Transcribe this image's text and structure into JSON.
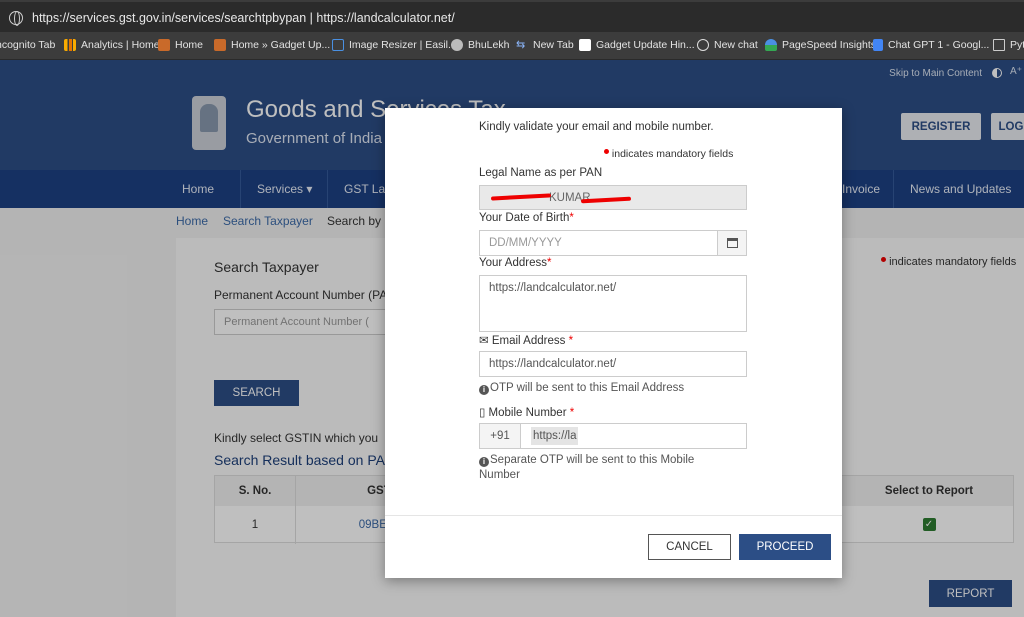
{
  "browser": {
    "url": "https://services.gst.gov.in/services/searchtpbypan | https://landcalculator.net/",
    "bookmarks": [
      {
        "label": "ncognito Tab",
        "icon": "incognito-icon",
        "color": "#888888"
      },
      {
        "label": "Analytics | Home",
        "icon": "analytics-icon",
        "color": "#f9ab00"
      },
      {
        "label": "Home",
        "icon": "gadget-icon",
        "color": "#f2994a"
      },
      {
        "label": "Home » Gadget Up...",
        "icon": "gadget-icon",
        "color": "#f2994a"
      },
      {
        "label": "Image Resizer | Easil...",
        "icon": "image-icon",
        "color": "#4a90e2"
      },
      {
        "label": "BhuLekh",
        "icon": "globe-icon",
        "color": "#cccccc"
      },
      {
        "label": "New Tab",
        "icon": "arrows-icon",
        "color": "#8ab4f8"
      },
      {
        "label": "Gadget Update Hin...",
        "icon": "gadget-icon",
        "color": "#ffffff"
      },
      {
        "label": "New chat",
        "icon": "chatgpt-icon",
        "color": "#dddddd"
      },
      {
        "label": "PageSpeed Insights",
        "icon": "pagespeed-icon",
        "color": "#4a90e2"
      },
      {
        "label": "Chat GPT 1 - Googl...",
        "icon": "docs-icon",
        "color": "#4285f4"
      },
      {
        "label": "Pyt",
        "icon": "folder-icon",
        "color": "#cccccc"
      }
    ]
  },
  "gst": {
    "skip": "Skip to Main Content",
    "a_plus": "A⁺",
    "title": "Goods and Services Tax",
    "subtitle": "Government of India",
    "register": "REGISTER",
    "login": "LOG",
    "nav": [
      "Home",
      "Services ▾",
      "GST Law",
      "Invoice",
      "News and Updates"
    ],
    "breadcrumb": [
      "Home",
      "Search Taxpayer",
      "Search by"
    ],
    "search_title": "Search Taxpayer",
    "pan_label": "Permanent Account Number (PA",
    "pan_placeholder": "Permanent Account Number (",
    "mandatory_note": "indicates mandatory fields",
    "search_btn": "SEARCH",
    "select_hint": "Kindly select GSTIN which you",
    "result_title": "Search Result based on PA",
    "table_headers": [
      "S. No.",
      "GSTI",
      "Select to Report"
    ],
    "table_row": {
      "sno": "1",
      "gstin": "09BEPP",
      "check": "✓"
    },
    "report_btn": "REPORT"
  },
  "modal": {
    "intro": "Kindly validate your email and mobile number.",
    "mandatory": "indicates mandatory fields",
    "legal_name_label": "Legal Name as per PAN",
    "legal_name_value": "KUMAR",
    "dob_label": "Your Date of Birth",
    "dob_placeholder": "DD/MM/YYYY",
    "address_label": "Your Address",
    "address_value": "https://landcalculator.net/",
    "email_label": "Email Address",
    "email_value": "https://landcalculator.net/",
    "email_note": "OTP will be sent to this Email Address",
    "mobile_label": "Mobile Number",
    "mobile_prefix": "+91",
    "mobile_value": "https://la",
    "mobile_note_1": "Separate OTP will be sent to this Mobile",
    "mobile_note_2": "Number",
    "required_mark": "*",
    "cancel": "CANCEL",
    "proceed": "PROCEED"
  }
}
